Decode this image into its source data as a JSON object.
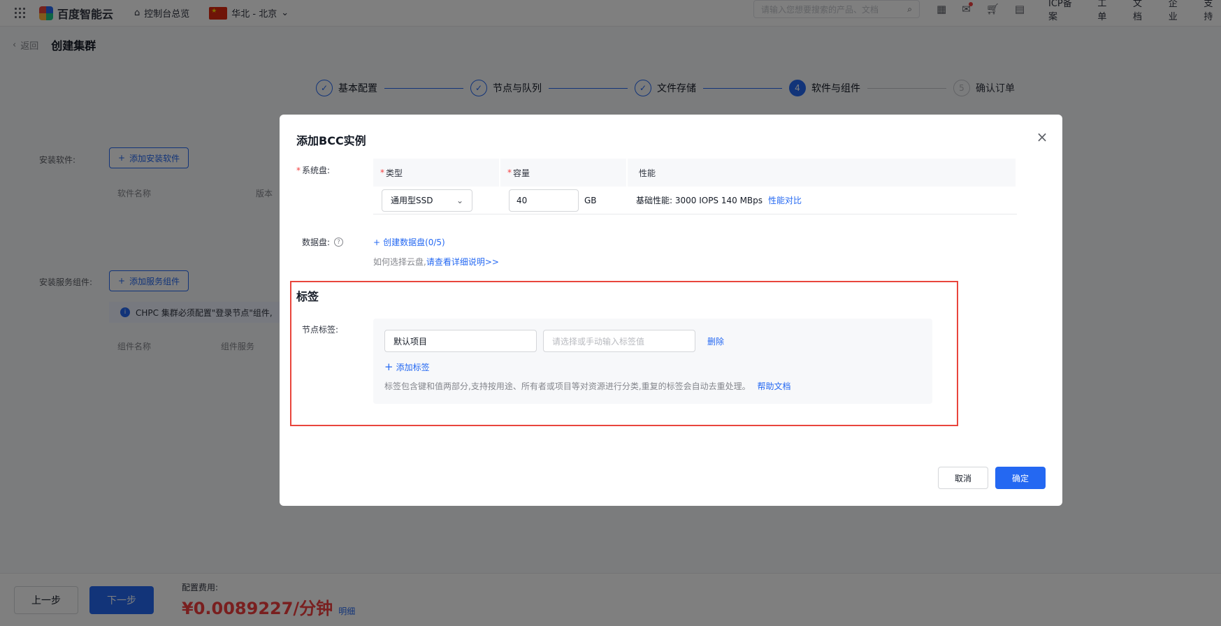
{
  "topnav": {
    "brand": "百度智能云",
    "console_link": "控制台总览",
    "region": "华北 - 北京",
    "search_placeholder": "请输入您想要搜索的产品、文档",
    "links": [
      "ICP备案",
      "工单",
      "文档",
      "企业",
      "支持"
    ]
  },
  "page": {
    "back_label": "返回",
    "title": "创建集群"
  },
  "steps": [
    {
      "label": "基本配置",
      "state": "done",
      "mark": "✓"
    },
    {
      "label": "节点与队列",
      "state": "done",
      "mark": "✓"
    },
    {
      "label": "文件存储",
      "state": "done",
      "mark": "✓"
    },
    {
      "label": "软件与组件",
      "state": "active",
      "mark": "4"
    },
    {
      "label": "确认订单",
      "state": "pending",
      "mark": "5"
    }
  ],
  "background_form": {
    "install_software_label": "安装软件:",
    "add_software_button": "添加安装软件",
    "software_table_headers": [
      "软件名称",
      "版本"
    ],
    "install_service_label": "安装服务组件:",
    "add_service_button": "添加服务组件",
    "service_info": "CHPC 集群必须配置\"登录节点\"组件,",
    "service_table_headers": [
      "组件名称",
      "组件服务"
    ]
  },
  "footer": {
    "prev_button": "上一步",
    "next_button": "下一步",
    "fee_label": "配置费用:",
    "fee_value": "¥0.0089227/分钟",
    "fee_detail_link": "明细"
  },
  "modal": {
    "title": "添加BCC实例",
    "system_disk_label": "系统盘:",
    "disk_table": {
      "headers": {
        "type": "类型",
        "capacity": "容量",
        "performance": "性能"
      },
      "type_value": "通用型SSD",
      "capacity_value": "40",
      "capacity_unit": "GB",
      "performance_text": "基础性能: 3000 IOPS 140 MBps",
      "performance_compare_link": "性能对比"
    },
    "data_disk_label": "数据盘:",
    "create_data_disk": "创建数据盘(0/5)",
    "disk_hint_prefix": "如何选择云盘,",
    "disk_hint_link": "请查看详细说明>>",
    "tag_section_title": "标签",
    "node_tag_label": "节点标签:",
    "tag_key_value": "默认项目",
    "tag_value_placeholder": "请选择或手动输入标签值",
    "tag_delete": "删除",
    "tag_add": "添加标签",
    "tag_hint": "标签包含键和值两部分,支持按用途、所有者或项目等对资源进行分类,重复的标签会自动去重处理。",
    "tag_help_link": "帮助文档",
    "cancel_button": "取消",
    "confirm_button": "确定"
  },
  "colors": {
    "primary": "#2468f2",
    "danger": "#f33e3e",
    "highlight_border": "#e8453c"
  }
}
